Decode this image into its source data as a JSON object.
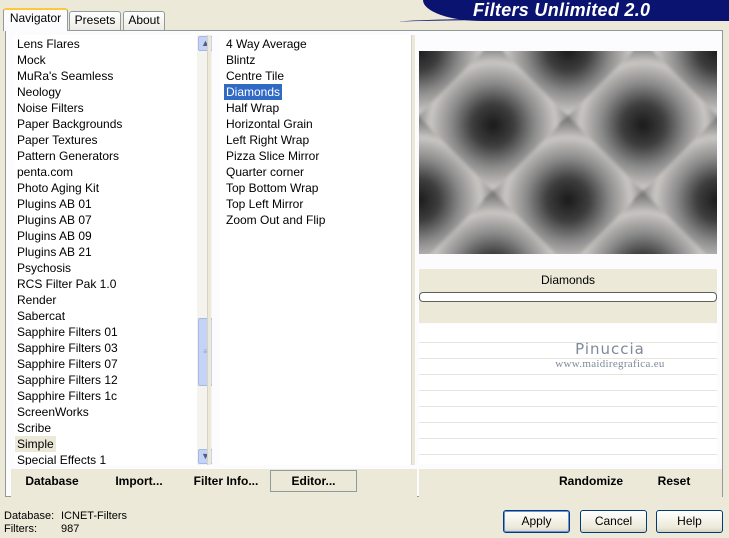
{
  "tabs": [
    {
      "label": "Navigator",
      "active": true
    },
    {
      "label": "Presets",
      "active": false
    },
    {
      "label": "About",
      "active": false
    }
  ],
  "banner": {
    "title": "Filters Unlimited 2.0"
  },
  "categories": [
    "Lens Flares",
    "Mock",
    "MuRa's Seamless",
    "Neology",
    "Noise Filters",
    "Paper Backgrounds",
    "Paper Textures",
    "Pattern Generators",
    "penta.com",
    "Photo Aging Kit",
    "Plugins AB 01",
    "Plugins AB 07",
    "Plugins AB 09",
    "Plugins AB 21",
    "Psychosis",
    "RCS Filter Pak 1.0",
    "Render",
    "Sabercat",
    "Sapphire Filters 01",
    "Sapphire Filters 03",
    "Sapphire Filters 07",
    "Sapphire Filters 12",
    "Sapphire Filters 1c",
    "ScreenWorks",
    "Scribe",
    "Simple",
    "Special Effects 1"
  ],
  "selected_category": "Simple",
  "filters": [
    "4 Way Average",
    "Blintz",
    "Centre Tile",
    "Diamonds",
    "Half Wrap",
    "Horizontal Grain",
    "Left Right Wrap",
    "Pizza Slice Mirror",
    "Quarter corner",
    "Top Bottom Wrap",
    "Top Left Mirror",
    "Zoom Out and Flip"
  ],
  "selected_filter": "Diamonds",
  "preview": {
    "filter_name": "Diamonds"
  },
  "watermark": {
    "title": "Pinuccia",
    "url": "www.maidiregrafica.eu"
  },
  "toolbar": {
    "database": "Database",
    "import": "Import...",
    "filter_info": "Filter Info...",
    "editor": "Editor...",
    "randomize": "Randomize",
    "reset": "Reset"
  },
  "status": {
    "database_label": "Database:",
    "database_value": "ICNET-Filters",
    "filters_label": "Filters:",
    "filters_value": "987"
  },
  "buttons": {
    "apply": "Apply",
    "cancel": "Cancel",
    "help": "Help"
  }
}
